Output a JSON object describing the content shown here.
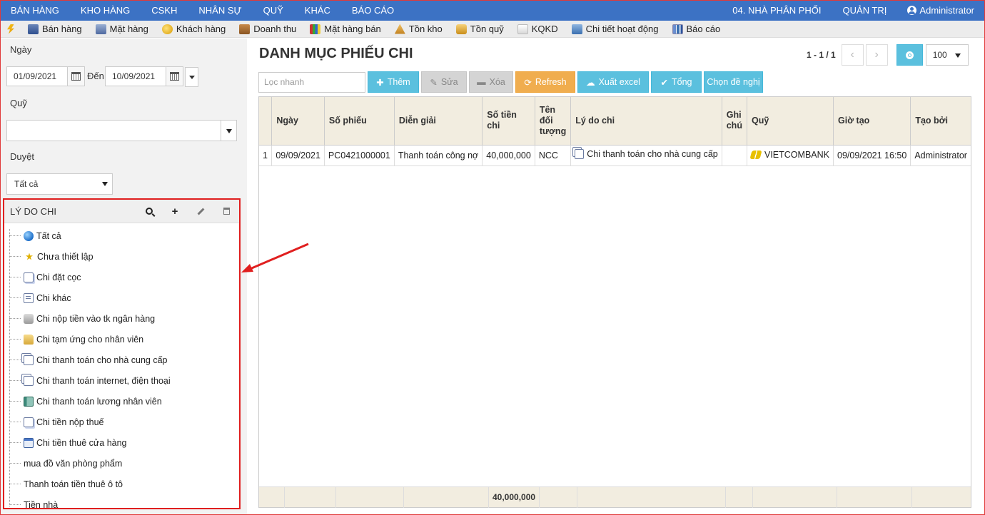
{
  "topnav": {
    "items": [
      "BÁN HÀNG",
      "KHO HÀNG",
      "CSKH",
      "NHÂN SỰ",
      "QUỸ",
      "KHÁC",
      "BÁO CÁO"
    ],
    "branch": "04. NHÀ PHÂN PHỐI",
    "admin_menu": "QUẢN TRỊ",
    "user": "Administrator"
  },
  "toolbar": {
    "items": [
      {
        "label": "Bán hàng",
        "icon": "cash-register-icon"
      },
      {
        "label": "Mặt hàng",
        "icon": "product-icon"
      },
      {
        "label": "Khách hàng",
        "icon": "customer-icon"
      },
      {
        "label": "Doanh thu",
        "icon": "revenue-icon"
      },
      {
        "label": "Mặt hàng bán",
        "icon": "sales-chart-icon"
      },
      {
        "label": "Tồn kho",
        "icon": "stock-icon"
      },
      {
        "label": "Tồn quỹ",
        "icon": "coins-icon"
      },
      {
        "label": "KQKD",
        "icon": "pulse-icon"
      },
      {
        "label": "Chi tiết hoạt động",
        "icon": "activity-icon"
      },
      {
        "label": "Báo cáo",
        "icon": "report-icon"
      }
    ]
  },
  "sidebar": {
    "date_label": "Ngày",
    "date_from": "01/09/2021",
    "to_label": "Đến",
    "date_to": "10/09/2021",
    "fund_label": "Quỹ",
    "fund_value": "",
    "approve_label": "Duyệt",
    "approve_value": "Tất cả",
    "reason_panel": {
      "title": "LÝ DO CHI",
      "items": [
        {
          "label": "Tất cả",
          "icon": "globe-icon"
        },
        {
          "label": "Chưa thiết lập",
          "icon": "star-icon"
        },
        {
          "label": "Chi đặt cọc",
          "icon": "document-question-icon"
        },
        {
          "label": "Chi khác",
          "icon": "document-icon"
        },
        {
          "label": "Chi nộp tiền vào tk ngân hàng",
          "icon": "printer-icon"
        },
        {
          "label": "Chi tạm ứng cho nhân viên",
          "icon": "folder-icon"
        },
        {
          "label": "Chi thanh toán cho nhà cung cấp",
          "icon": "copy-icon"
        },
        {
          "label": "Chi thanh toán internet, điện thoại",
          "icon": "copy-icon"
        },
        {
          "label": "Chi thanh toán lương nhân viên",
          "icon": "book-icon"
        },
        {
          "label": "Chi tiền nộp thuế",
          "icon": "document-question-icon"
        },
        {
          "label": "Chi tiền thuê cửa hàng",
          "icon": "window-icon"
        },
        {
          "label": "mua đồ văn phòng phẩm",
          "icon": ""
        },
        {
          "label": "Thanh toán tiền thuê ô tô",
          "icon": ""
        },
        {
          "label": "Tiền nhà",
          "icon": ""
        }
      ]
    }
  },
  "main": {
    "title": "DANH MỤC PHIẾU CHI",
    "pager_text": "1 - 1 / 1",
    "page_size": "100",
    "filter_placeholder": "Lọc nhanh",
    "buttons": {
      "add": "Thêm",
      "edit": "Sửa",
      "delete": "Xóa",
      "refresh": "Refresh",
      "export": "Xuất excel",
      "total": "Tổng",
      "suggest": "Chọn đề nghị"
    },
    "columns": [
      "",
      "Ngày",
      "Số phiếu",
      "Diễn giải",
      "Số tiền chi",
      "Tên đối tượng",
      "Lý do chi",
      "Ghi chú",
      "Quỹ",
      "Giờ tạo",
      "Tạo bởi"
    ],
    "rows": [
      {
        "no": "1",
        "date": "09/09/2021",
        "code": "PC0421000001",
        "desc": "Thanh toán công nợ",
        "amount": "40,000,000",
        "party": "NCC",
        "reason": "Chi thanh toán cho nhà cung cấp",
        "note": "",
        "fund": "VIETCOMBANK",
        "created": "09/09/2021 16:50",
        "by": "Administrator"
      }
    ],
    "footer_total": "40,000,000"
  },
  "colors": {
    "nav_bg": "#3c72c4",
    "info_button": "#5bc0de",
    "warning_button": "#f0ad4e",
    "highlight_border": "#e01f1f"
  }
}
